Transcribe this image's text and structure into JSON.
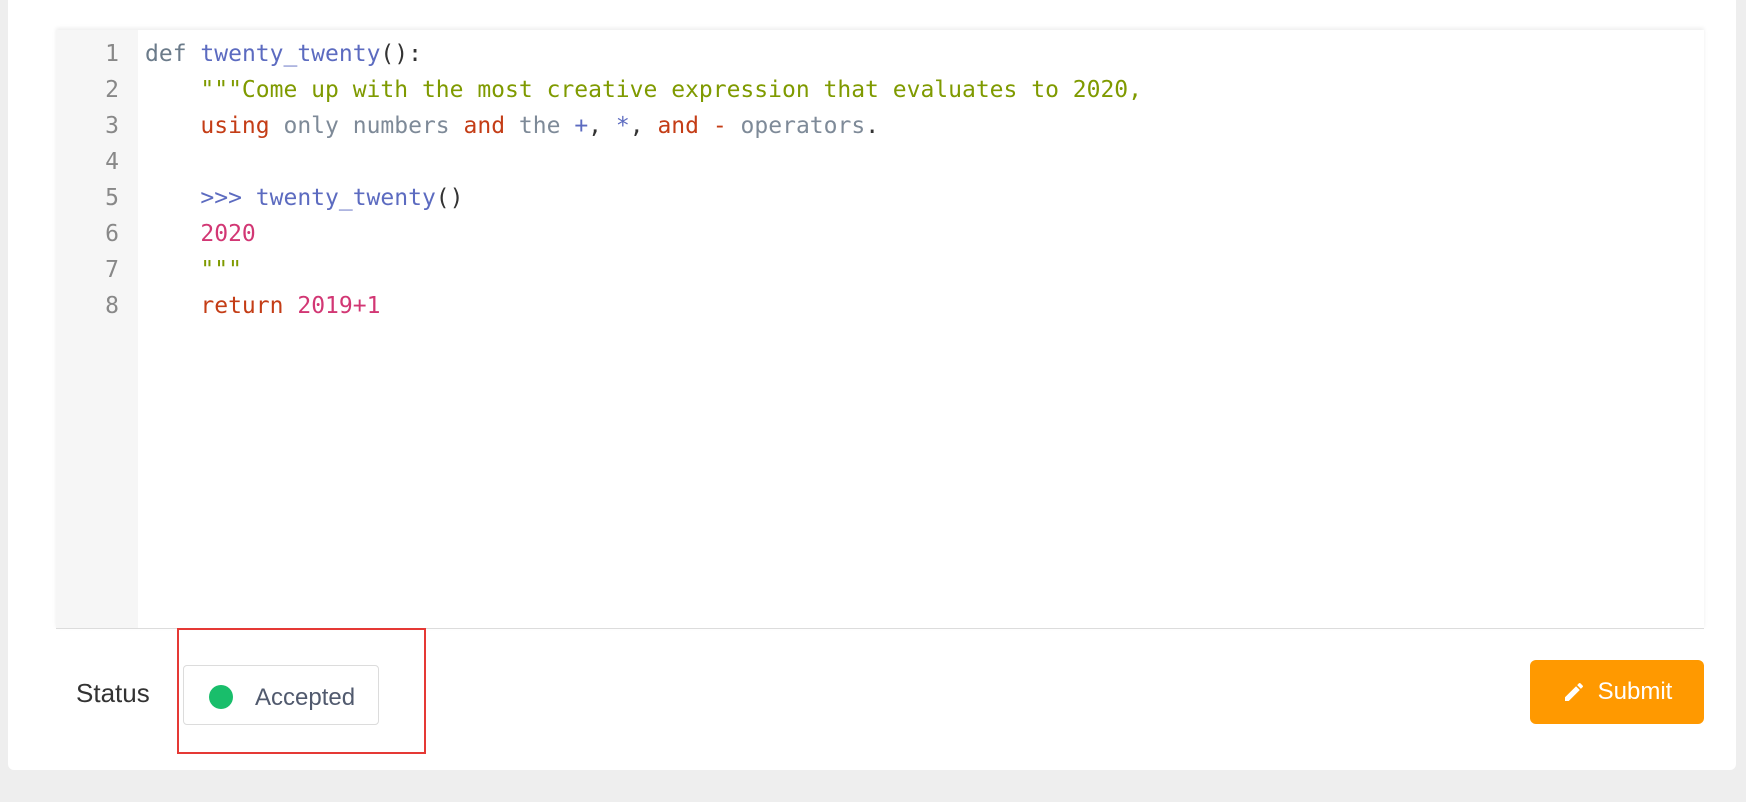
{
  "editor": {
    "line_numbers": [
      "1",
      "2",
      "3",
      "4",
      "5",
      "6",
      "7",
      "8"
    ],
    "lines": {
      "l1": {
        "def": "def",
        "fn": "twenty_twenty",
        "rest": "():"
      },
      "l2": {
        "indent": "    ",
        "str": "\"\"\"Come up with the most creative expression that evaluates to 2020,"
      },
      "l3": {
        "indent": "    ",
        "t1": "using",
        "t2": " only numbers ",
        "t3": "and",
        "t4": " the ",
        "t5": "+",
        "t6": ", ",
        "t7": "*",
        "t8": ", ",
        "t9": "and",
        "t10": " ",
        "t11": "-",
        "t12": " operators",
        "t13": "."
      },
      "l4": {
        "text": ""
      },
      "l5": {
        "indent": "    ",
        "prompt": ">>> ",
        "fn": "twenty_twenty",
        "rest": "()"
      },
      "l6": {
        "indent": "    ",
        "num": "2020"
      },
      "l7": {
        "indent": "    ",
        "str": "\"\"\""
      },
      "l8": {
        "indent": "    ",
        "kw": "return",
        "sp": " ",
        "n1": "2019",
        "op": "+",
        "n2": "1"
      }
    }
  },
  "footer": {
    "status_label": "Status",
    "status_value": "Accepted",
    "status_color": "#19be6b",
    "submit_label": "Submit",
    "submit_icon": "pencil-icon",
    "submit_color": "#ff9900",
    "highlight_color": "#e53935"
  }
}
